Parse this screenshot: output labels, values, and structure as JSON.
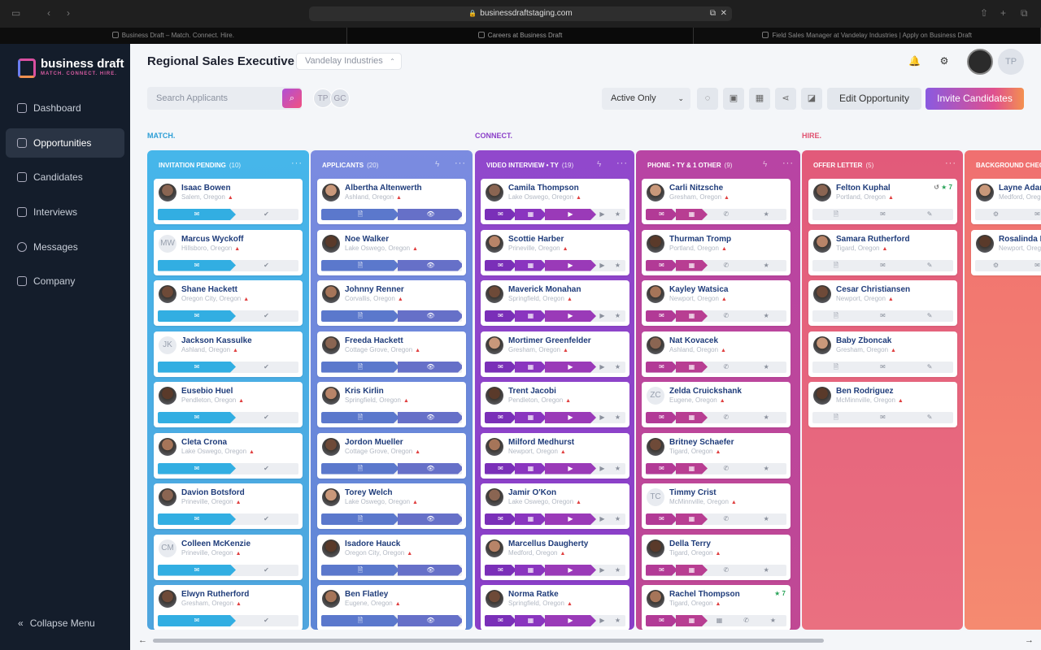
{
  "browser": {
    "url": "businessdraftstaging.com",
    "tabs": [
      "Business Draft – Match. Connect. Hire.",
      "Careers at Business Draft",
      "Field Sales Manager at Vandelay Industries | Apply on Business Draft"
    ]
  },
  "brand": {
    "name": "business draft",
    "tagline": "MATCH. CONNECT. HIRE."
  },
  "sidebar": {
    "items": [
      {
        "label": "Dashboard",
        "icon": "home-icon"
      },
      {
        "label": "Opportunities",
        "icon": "briefcase-icon",
        "active": true
      },
      {
        "label": "Candidates",
        "icon": "users-icon"
      },
      {
        "label": "Interviews",
        "icon": "calendar-icon"
      },
      {
        "label": "Messages",
        "icon": "chat-icon"
      },
      {
        "label": "Company",
        "icon": "building-icon"
      }
    ],
    "collapse_label": "Collapse Menu"
  },
  "header": {
    "job_title": "Regional Sales Executive",
    "company": "Vandelay Industries",
    "user_initials": "TP"
  },
  "toolbar": {
    "search_placeholder": "Search Applicants",
    "team": [
      "TP",
      "GC"
    ],
    "filter_value": "Active Only",
    "edit_label": "Edit Opportunity",
    "invite_label": "Invite Candidates"
  },
  "stages": [
    "MATCH.",
    "CONNECT.",
    "HIRE."
  ],
  "colors": {
    "match": "#3ab0e0",
    "connect": "#8b3ec8",
    "hire": "#e2587a",
    "name": "#1f3c7a",
    "warn": "#e04040"
  },
  "columns": [
    {
      "title": "INVITATION PENDING",
      "count": "(10)",
      "cards": [
        {
          "name": "Isaac Bowen",
          "location": "Salem, Oregon",
          "avatar": "photo"
        },
        {
          "name": "Marcus Wyckoff",
          "location": "Hillsboro, Oregon",
          "avatar": "MW"
        },
        {
          "name": "Shane Hackett",
          "location": "Oregon City, Oregon",
          "avatar": "photo"
        },
        {
          "name": "Jackson Kassulke",
          "location": "Ashland, Oregon",
          "avatar": "JK"
        },
        {
          "name": "Eusebio Huel",
          "location": "Pendleton, Oregon",
          "avatar": "photo"
        },
        {
          "name": "Cleta Crona",
          "location": "Lake Oswego, Oregon",
          "avatar": "photo"
        },
        {
          "name": "Davion Botsford",
          "location": "Prineville, Oregon",
          "avatar": "photo"
        },
        {
          "name": "Colleen McKenzie",
          "location": "Prineville, Oregon",
          "avatar": "CM"
        },
        {
          "name": "Elwyn Rutherford",
          "location": "Gresham, Oregon",
          "avatar": "photo"
        }
      ]
    },
    {
      "title": "APPLICANTS",
      "count": "(20)",
      "cards": [
        {
          "name": "Albertha Altenwerth",
          "location": "Ashland, Oregon",
          "avatar": "photo"
        },
        {
          "name": "Noe Walker",
          "location": "Lake Oswego, Oregon",
          "avatar": "photo"
        },
        {
          "name": "Johnny Renner",
          "location": "Corvallis, Oregon",
          "avatar": "photo"
        },
        {
          "name": "Freeda Hackett",
          "location": "Cottage Grove, Oregon",
          "avatar": "photo"
        },
        {
          "name": "Kris Kirlin",
          "location": "Springfield, Oregon",
          "avatar": "photo"
        },
        {
          "name": "Jordon Mueller",
          "location": "Cottage Grove, Oregon",
          "avatar": "photo"
        },
        {
          "name": "Torey Welch",
          "location": "Lake Oswego, Oregon",
          "avatar": "photo"
        },
        {
          "name": "Isadore Hauck",
          "location": "Oregon City, Oregon",
          "avatar": "photo"
        },
        {
          "name": "Ben Flatley",
          "location": "Eugene, Oregon",
          "avatar": "photo"
        }
      ]
    },
    {
      "title": "VIDEO INTERVIEW • TY",
      "count": "(19)",
      "cards": [
        {
          "name": "Camila Thompson",
          "location": "Lake Oswego, Oregon",
          "avatar": "photo"
        },
        {
          "name": "Scottie Harber",
          "location": "Prineville, Oregon",
          "avatar": "photo"
        },
        {
          "name": "Maverick Monahan",
          "location": "Springfield, Oregon",
          "avatar": "photo"
        },
        {
          "name": "Mortimer Greenfelder",
          "location": "Gresham, Oregon",
          "avatar": "photo"
        },
        {
          "name": "Trent Jacobi",
          "location": "Pendleton, Oregon",
          "avatar": "photo"
        },
        {
          "name": "Milford Medhurst",
          "location": "Newport, Oregon",
          "avatar": "photo"
        },
        {
          "name": "Jamir O'Kon",
          "location": "Lake Oswego, Oregon",
          "avatar": "photo"
        },
        {
          "name": "Marcellus Daugherty",
          "location": "Medford, Oregon",
          "avatar": "photo"
        },
        {
          "name": "Norma Ratke",
          "location": "Springfield, Oregon",
          "avatar": "photo"
        }
      ]
    },
    {
      "title": "PHONE • TY & 1 OTHER",
      "count": "(9)",
      "cards": [
        {
          "name": "Carli Nitzsche",
          "location": "Gresham, Oregon",
          "avatar": "photo"
        },
        {
          "name": "Thurman Tromp",
          "location": "Portland, Oregon",
          "avatar": "photo"
        },
        {
          "name": "Kayley Watsica",
          "location": "Newport, Oregon",
          "avatar": "photo"
        },
        {
          "name": "Nat Kovacek",
          "location": "Ashland, Oregon",
          "avatar": "photo"
        },
        {
          "name": "Zelda Cruickshank",
          "location": "Eugene, Oregon",
          "avatar": "ZC"
        },
        {
          "name": "Britney Schaefer",
          "location": "Tigard, Oregon",
          "avatar": "photo"
        },
        {
          "name": "Timmy Crist",
          "location": "McMinnville, Oregon",
          "avatar": "TC"
        },
        {
          "name": "Della Terry",
          "location": "Tigard, Oregon",
          "avatar": "photo"
        },
        {
          "name": "Rachel Thompson",
          "location": "Tigard, Oregon",
          "avatar": "photo",
          "rating": "★ 7"
        }
      ]
    },
    {
      "title": "OFFER LETTER",
      "count": "(5)",
      "cards": [
        {
          "name": "Felton Kuphal",
          "location": "Portland, Oregon",
          "avatar": "photo",
          "rating": "★ 7"
        },
        {
          "name": "Samara Rutherford",
          "location": "Tigard, Oregon",
          "avatar": "photo"
        },
        {
          "name": "Cesar Christiansen",
          "location": "Newport, Oregon",
          "avatar": "photo"
        },
        {
          "name": "Baby Zboncak",
          "location": "Gresham, Oregon",
          "avatar": "photo"
        },
        {
          "name": "Ben Rodriguez",
          "location": "McMinnville, Oregon",
          "avatar": "photo"
        }
      ]
    },
    {
      "title": "BACKGROUND CHECK",
      "count": "",
      "cards": [
        {
          "name": "Layne Adams",
          "location": "Medford, Oregon",
          "avatar": "photo"
        },
        {
          "name": "Rosalinda F",
          "location": "Newport, Oregon",
          "avatar": "photo"
        }
      ]
    }
  ]
}
